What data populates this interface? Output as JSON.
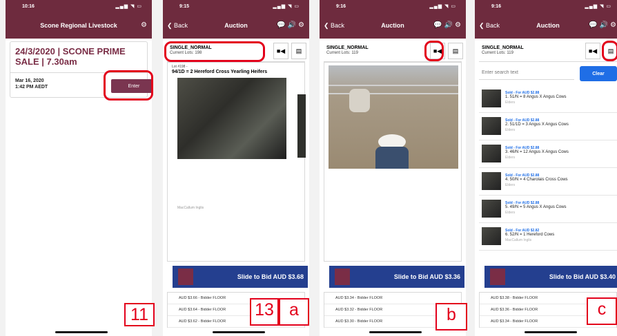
{
  "phones": {
    "p1": {
      "time": "10:16",
      "title": "Scone Regional Livestock",
      "sale_title": "24/3/2020 | SCONE PRIME SALE | 7.30am",
      "sale_date": "Mar 16, 2020",
      "sale_time": "1:42 PM AEDT",
      "enter": "Enter",
      "label": "11"
    },
    "p2": {
      "time": "9:15",
      "back": "Back",
      "title": "Auction",
      "lot_type": "SINGLE_NORMAL",
      "lot_count": "Current Lots: 198",
      "lot_num": "Lot #198 -",
      "lot_desc": "94/1D = 2 Hereford Cross Yearling Heifers",
      "agent": "MacCallum Inglis",
      "slide": "Slide to Bid AUD $3.68",
      "bids": [
        "AUD $3.66 - Bidder FLOOR",
        "AUD $3.64 - Bidder FLOOR",
        "AUD $3.62 - Bidder FLOOR"
      ],
      "label13": "13",
      "label_a": "a"
    },
    "p3": {
      "time": "9:16",
      "back": "Back",
      "title": "Auction",
      "lot_type": "SINGLE_NORMAL",
      "lot_count": "Current Lots: 119",
      "slide": "Slide to Bid AUD $3.36",
      "bids": [
        "AUD $3.34 - Bidder FLOOR",
        "AUD $3.32 - Bidder FLOOR",
        "AUD $3.30 - Bidder FLOOR"
      ],
      "label": "b"
    },
    "p4": {
      "time": "9:16",
      "back": "Back",
      "title": "Auction",
      "lot_type": "SINGLE_NORMAL",
      "lot_count": "Current Lots: 119",
      "search_placeholder": "Enter search text",
      "clear": "Clear",
      "lots": [
        {
          "sold": "Sold - For AUD $2.88",
          "desc": "1. 51/N = 8 Angus X Angus Cows",
          "vendor": "Elders"
        },
        {
          "sold": "Sold - For AUD $2.88",
          "desc": "2. 51/1D = 3 Angus X Angus Cows",
          "vendor": "Elders"
        },
        {
          "sold": "Sold - For AUD $2.88",
          "desc": "3. 46/N = 12 Angus X Angus Cows",
          "vendor": "Elders"
        },
        {
          "sold": "Sold - For AUD $2.88",
          "desc": "4. 50/N = 4 Charolais Cross Cows",
          "vendor": "Elders"
        },
        {
          "sold": "Sold - For AUD $2.88",
          "desc": "5. 49/N = 5 Angus X Angus Cows",
          "vendor": "Elders"
        },
        {
          "sold": "Sold - For AUD $2.82",
          "desc": "6. 52/N = 1 Hereford Cows",
          "vendor": "MacCallum Inglis"
        }
      ],
      "slide": "Slide to Bid AUD $3.40",
      "bids": [
        "AUD $3.38 - Bidder FLOOR",
        "AUD $3.36 - Bidder FLOOR",
        "AUD $3.34 - Bidder FLOOR"
      ],
      "label": "c"
    }
  },
  "colors": {
    "maroon": "#6e2b3e",
    "slider_blue": "#243f8f",
    "clear_blue": "#1f6ee6",
    "highlight_red": "#e3001b"
  },
  "icons": [
    "settings-icon",
    "chat-icon",
    "speaker-icon",
    "camera-icon",
    "catalogue-icon",
    "back-chevron-icon"
  ]
}
